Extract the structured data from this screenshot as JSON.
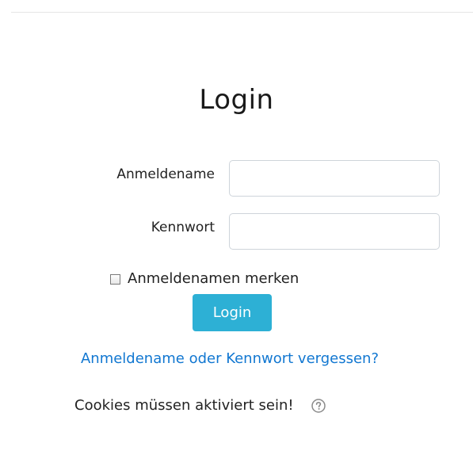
{
  "page": {
    "title": "Login"
  },
  "form": {
    "username_label": "Anmeldename",
    "username_value": "",
    "password_label": "Kennwort",
    "password_value": "",
    "remember_label": "Anmeldenamen merken",
    "remember_checked": false,
    "login_button": "Login",
    "forgot_link": "Anmeldename oder Kennwort vergessen?"
  },
  "notice": {
    "cookies_text": "Cookies müssen aktiviert sein!",
    "help_icon": "question-circle-icon"
  },
  "colors": {
    "accent": "#2db0d5",
    "link": "#1177d1"
  }
}
